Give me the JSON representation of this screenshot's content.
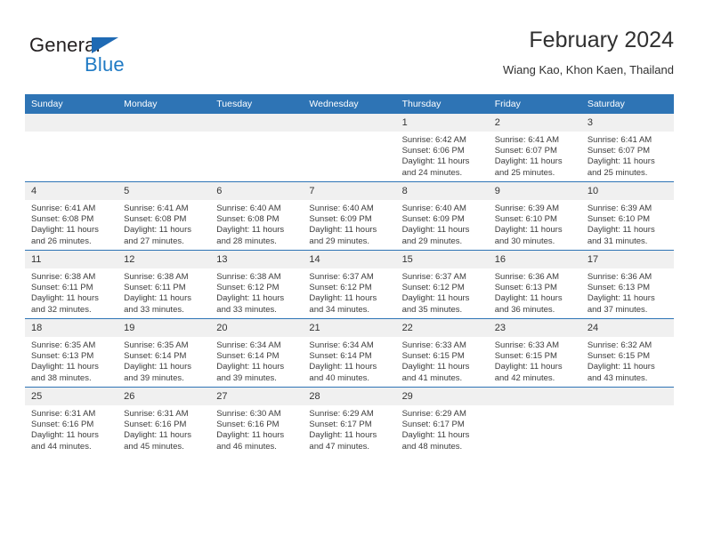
{
  "brand": {
    "name_top": "General",
    "name_bottom": "Blue",
    "triangle_color": "#1f6ab4",
    "text_color": "#1f7ac4"
  },
  "header": {
    "title": "February 2024",
    "subtitle": "Wiang Kao, Khon Kaen, Thailand"
  },
  "theme": {
    "header_blue": "#2e74b5",
    "daynum_gray": "#f0f0f0",
    "body_text": "#3c3c3c"
  },
  "weekdays": [
    "Sunday",
    "Monday",
    "Tuesday",
    "Wednesday",
    "Thursday",
    "Friday",
    "Saturday"
  ],
  "weeks": [
    [
      {
        "day": "",
        "sunrise": "",
        "sunset": "",
        "daylight": ""
      },
      {
        "day": "",
        "sunrise": "",
        "sunset": "",
        "daylight": ""
      },
      {
        "day": "",
        "sunrise": "",
        "sunset": "",
        "daylight": ""
      },
      {
        "day": "",
        "sunrise": "",
        "sunset": "",
        "daylight": ""
      },
      {
        "day": "1",
        "sunrise": "Sunrise: 6:42 AM",
        "sunset": "Sunset: 6:06 PM",
        "daylight": "Daylight: 11 hours and 24 minutes."
      },
      {
        "day": "2",
        "sunrise": "Sunrise: 6:41 AM",
        "sunset": "Sunset: 6:07 PM",
        "daylight": "Daylight: 11 hours and 25 minutes."
      },
      {
        "day": "3",
        "sunrise": "Sunrise: 6:41 AM",
        "sunset": "Sunset: 6:07 PM",
        "daylight": "Daylight: 11 hours and 25 minutes."
      }
    ],
    [
      {
        "day": "4",
        "sunrise": "Sunrise: 6:41 AM",
        "sunset": "Sunset: 6:08 PM",
        "daylight": "Daylight: 11 hours and 26 minutes."
      },
      {
        "day": "5",
        "sunrise": "Sunrise: 6:41 AM",
        "sunset": "Sunset: 6:08 PM",
        "daylight": "Daylight: 11 hours and 27 minutes."
      },
      {
        "day": "6",
        "sunrise": "Sunrise: 6:40 AM",
        "sunset": "Sunset: 6:08 PM",
        "daylight": "Daylight: 11 hours and 28 minutes."
      },
      {
        "day": "7",
        "sunrise": "Sunrise: 6:40 AM",
        "sunset": "Sunset: 6:09 PM",
        "daylight": "Daylight: 11 hours and 29 minutes."
      },
      {
        "day": "8",
        "sunrise": "Sunrise: 6:40 AM",
        "sunset": "Sunset: 6:09 PM",
        "daylight": "Daylight: 11 hours and 29 minutes."
      },
      {
        "day": "9",
        "sunrise": "Sunrise: 6:39 AM",
        "sunset": "Sunset: 6:10 PM",
        "daylight": "Daylight: 11 hours and 30 minutes."
      },
      {
        "day": "10",
        "sunrise": "Sunrise: 6:39 AM",
        "sunset": "Sunset: 6:10 PM",
        "daylight": "Daylight: 11 hours and 31 minutes."
      }
    ],
    [
      {
        "day": "11",
        "sunrise": "Sunrise: 6:38 AM",
        "sunset": "Sunset: 6:11 PM",
        "daylight": "Daylight: 11 hours and 32 minutes."
      },
      {
        "day": "12",
        "sunrise": "Sunrise: 6:38 AM",
        "sunset": "Sunset: 6:11 PM",
        "daylight": "Daylight: 11 hours and 33 minutes."
      },
      {
        "day": "13",
        "sunrise": "Sunrise: 6:38 AM",
        "sunset": "Sunset: 6:12 PM",
        "daylight": "Daylight: 11 hours and 33 minutes."
      },
      {
        "day": "14",
        "sunrise": "Sunrise: 6:37 AM",
        "sunset": "Sunset: 6:12 PM",
        "daylight": "Daylight: 11 hours and 34 minutes."
      },
      {
        "day": "15",
        "sunrise": "Sunrise: 6:37 AM",
        "sunset": "Sunset: 6:12 PM",
        "daylight": "Daylight: 11 hours and 35 minutes."
      },
      {
        "day": "16",
        "sunrise": "Sunrise: 6:36 AM",
        "sunset": "Sunset: 6:13 PM",
        "daylight": "Daylight: 11 hours and 36 minutes."
      },
      {
        "day": "17",
        "sunrise": "Sunrise: 6:36 AM",
        "sunset": "Sunset: 6:13 PM",
        "daylight": "Daylight: 11 hours and 37 minutes."
      }
    ],
    [
      {
        "day": "18",
        "sunrise": "Sunrise: 6:35 AM",
        "sunset": "Sunset: 6:13 PM",
        "daylight": "Daylight: 11 hours and 38 minutes."
      },
      {
        "day": "19",
        "sunrise": "Sunrise: 6:35 AM",
        "sunset": "Sunset: 6:14 PM",
        "daylight": "Daylight: 11 hours and 39 minutes."
      },
      {
        "day": "20",
        "sunrise": "Sunrise: 6:34 AM",
        "sunset": "Sunset: 6:14 PM",
        "daylight": "Daylight: 11 hours and 39 minutes."
      },
      {
        "day": "21",
        "sunrise": "Sunrise: 6:34 AM",
        "sunset": "Sunset: 6:14 PM",
        "daylight": "Daylight: 11 hours and 40 minutes."
      },
      {
        "day": "22",
        "sunrise": "Sunrise: 6:33 AM",
        "sunset": "Sunset: 6:15 PM",
        "daylight": "Daylight: 11 hours and 41 minutes."
      },
      {
        "day": "23",
        "sunrise": "Sunrise: 6:33 AM",
        "sunset": "Sunset: 6:15 PM",
        "daylight": "Daylight: 11 hours and 42 minutes."
      },
      {
        "day": "24",
        "sunrise": "Sunrise: 6:32 AM",
        "sunset": "Sunset: 6:15 PM",
        "daylight": "Daylight: 11 hours and 43 minutes."
      }
    ],
    [
      {
        "day": "25",
        "sunrise": "Sunrise: 6:31 AM",
        "sunset": "Sunset: 6:16 PM",
        "daylight": "Daylight: 11 hours and 44 minutes."
      },
      {
        "day": "26",
        "sunrise": "Sunrise: 6:31 AM",
        "sunset": "Sunset: 6:16 PM",
        "daylight": "Daylight: 11 hours and 45 minutes."
      },
      {
        "day": "27",
        "sunrise": "Sunrise: 6:30 AM",
        "sunset": "Sunset: 6:16 PM",
        "daylight": "Daylight: 11 hours and 46 minutes."
      },
      {
        "day": "28",
        "sunrise": "Sunrise: 6:29 AM",
        "sunset": "Sunset: 6:17 PM",
        "daylight": "Daylight: 11 hours and 47 minutes."
      },
      {
        "day": "29",
        "sunrise": "Sunrise: 6:29 AM",
        "sunset": "Sunset: 6:17 PM",
        "daylight": "Daylight: 11 hours and 48 minutes."
      },
      {
        "day": "",
        "sunrise": "",
        "sunset": "",
        "daylight": ""
      },
      {
        "day": "",
        "sunrise": "",
        "sunset": "",
        "daylight": ""
      }
    ]
  ]
}
